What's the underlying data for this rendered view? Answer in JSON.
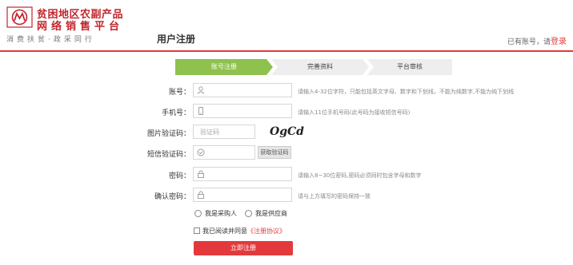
{
  "header": {
    "logo_line1": "贫困地区农副产品",
    "logo_line2": "网络销售平台",
    "slogan": "消费扶贫·政采同行",
    "page_title": "用户注册",
    "login_prompt": "已有账号，请",
    "login_link": "登录"
  },
  "steps": [
    "账号注册",
    "完善资料",
    "平台审核"
  ],
  "form": {
    "account": {
      "label": "账号：",
      "placeholder": "",
      "hint": "请输入4-32位字符，只能包括英文字母、数字和下划线，不能为纯数字,不能为纯下划线"
    },
    "phone": {
      "label": "手机号：",
      "placeholder": "",
      "hint": "请输入11位手机号码(此号码为接收短信号码)"
    },
    "captcha": {
      "label": "图片验证码：",
      "placeholder": "验证码",
      "image_text": "OgCd"
    },
    "sms": {
      "label": "短信验证码：",
      "placeholder": "",
      "button": "获取验证码"
    },
    "password": {
      "label": "密码：",
      "placeholder": "",
      "hint": "请输入8~30位密码,密码必须同时包含字母和数字"
    },
    "confirm": {
      "label": "确认密码：",
      "placeholder": "",
      "hint": "请与上方填写的密码保持一致"
    },
    "role_buyer": "我是采购人",
    "role_supplier": "我是供应商",
    "agree_text": "我已阅读并同意",
    "agree_link": "《注册协议》",
    "submit": "立即注册"
  },
  "colors": {
    "brand_red": "#e4393c",
    "step_active": "#8fc14e"
  }
}
